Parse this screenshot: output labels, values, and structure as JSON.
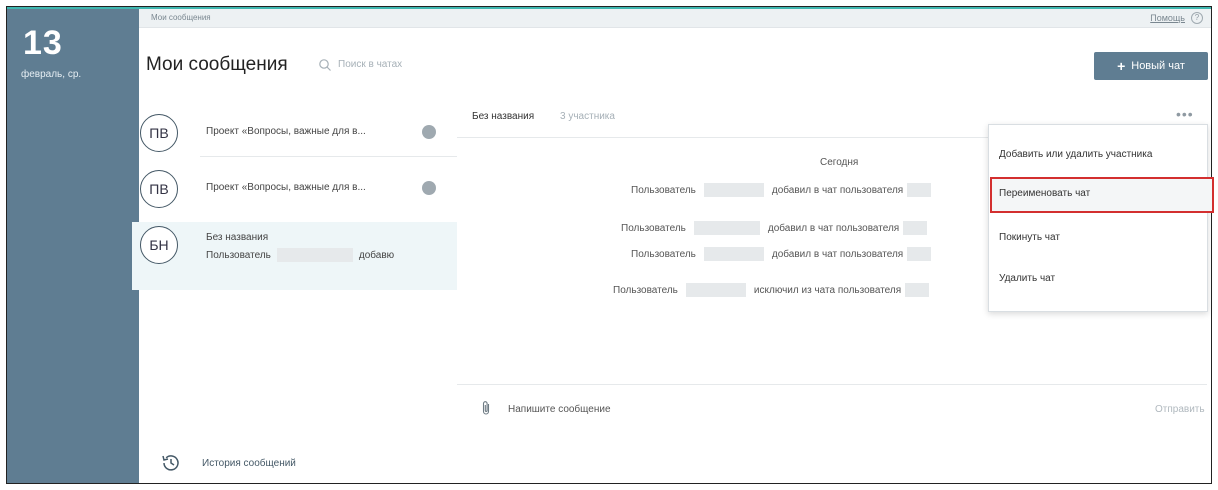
{
  "date_panel": {
    "day": "13",
    "weekday": "февраль, ср."
  },
  "breadcrumb": "Мои сообщения",
  "help": {
    "label": "Помощь",
    "icon": "?"
  },
  "header": {
    "title": "Мои сообщения",
    "search_placeholder": "Поиск в чатах",
    "new_chat": "Новый чат"
  },
  "chats": [
    {
      "avatar": "ПВ",
      "title": "Проект «Вопросы, важные для в...",
      "badge": ""
    },
    {
      "avatar": "ПВ",
      "title": "Проект «Вопросы, важные для в...",
      "badge": ""
    },
    {
      "avatar": "БН",
      "title": "Без названия",
      "preview_left": "Пользователь",
      "preview_right": "добавю"
    }
  ],
  "history": "История сообщений",
  "conversation": {
    "name": "Без названия",
    "participants": "3 участника",
    "more": "•••",
    "date": "Сегодня",
    "messages": [
      {
        "left": "Пользователь",
        "right": "добавил в чат пользователя"
      },
      {
        "left": "Пользователь",
        "right": "добавил в чат пользователя"
      },
      {
        "left": "Пользователь",
        "right": "добавил в чат пользователя"
      },
      {
        "left": "Пользователь",
        "right": "исключил из чата пользователя"
      }
    ]
  },
  "compose": {
    "placeholder": "Напишите сообщение",
    "send": "Отправить"
  },
  "menu": {
    "items": [
      "Добавить или удалить участника",
      "Переименовать чат",
      "Покинуть чат",
      "Удалить чат"
    ],
    "highlight_color": "#d32f2f"
  },
  "colors": {
    "accent": "#5f7d92",
    "teal": "#3fb7b0"
  }
}
